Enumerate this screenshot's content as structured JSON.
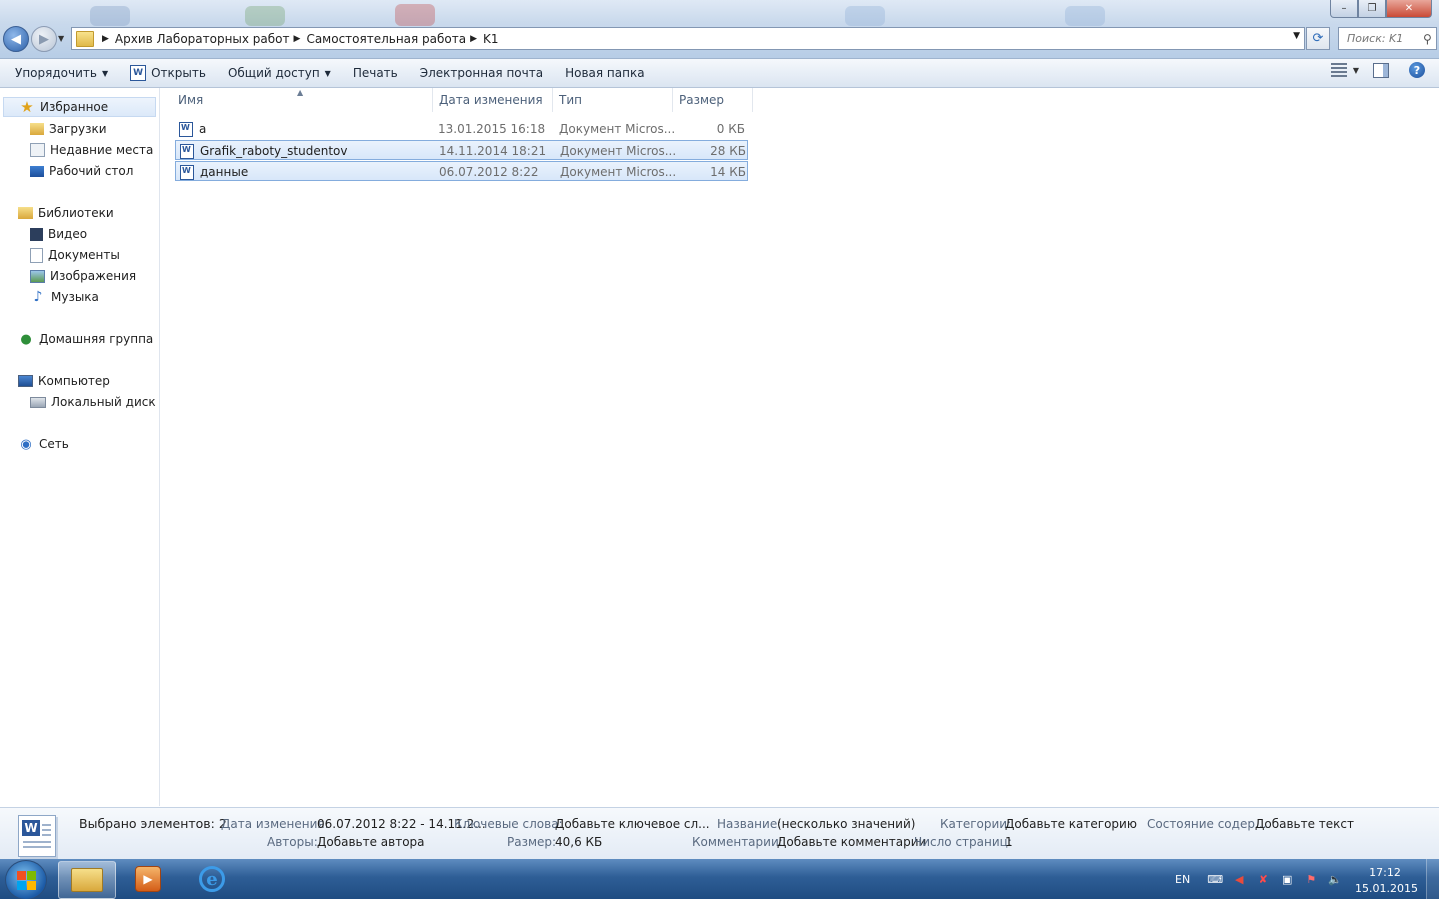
{
  "window": {
    "controls": {
      "minimize": "–",
      "maximize": "❐",
      "close": "✕"
    }
  },
  "address": {
    "breadcrumbs": [
      "Архив Лабораторных работ",
      "Самостоятельная работа",
      "K1"
    ],
    "search_placeholder": "Поиск: K1"
  },
  "toolbar": {
    "organize": "Упорядочить",
    "open": "Открыть",
    "share": "Общий доступ",
    "print": "Печать",
    "email": "Электронная почта",
    "new_folder": "Новая папка"
  },
  "nav": {
    "favorites": "Избранное",
    "downloads": "Загрузки",
    "recent": "Недавние места",
    "desktop": "Рабочий стол",
    "libraries": "Библиотеки",
    "video": "Видео",
    "documents": "Документы",
    "images": "Изображения",
    "music": "Музыка",
    "homegroup": "Домашняя группа",
    "computer": "Компьютер",
    "local_disk": "Локальный диск (С:",
    "network": "Сеть"
  },
  "columns": {
    "name": "Имя",
    "date": "Дата изменения",
    "type": "Тип",
    "size": "Размер"
  },
  "files": [
    {
      "name": "а",
      "date": "13.01.2015 16:18",
      "type": "Документ Micros...",
      "size": "0 КБ",
      "selected": false
    },
    {
      "name": "Grafik_raboty_studentov",
      "date": "14.11.2014 18:21",
      "type": "Документ Micros...",
      "size": "28 КБ",
      "selected": true
    },
    {
      "name": "данные",
      "date": "06.07.2012 8:22",
      "type": "Документ Micros...",
      "size": "14 КБ",
      "selected": true
    }
  ],
  "details": {
    "selected_count": "Выбрано элементов: 2",
    "date_label": "Дата изменения:",
    "date_value": "06.07.2012 8:22 - 14.11.2...",
    "keywords_label": "Ключевые слова:",
    "keywords_value": "Добавьте ключевое сл...",
    "title_label": "Название:",
    "title_value": "(несколько значений)",
    "categories_label": "Категории:",
    "categories_value": "Добавьте категорию",
    "status_label": "Состояние содер...",
    "status_value": "Добавьте текст",
    "authors_label": "Авторы:",
    "authors_value": "Добавьте автора",
    "size_label": "Размер:",
    "size_value": "40,6 КБ",
    "comments_label": "Комментарии:",
    "comments_value": "Добавьте комментарии",
    "pages_label": "Число страниц:",
    "pages_value": "1"
  },
  "taskbar": {
    "lang": "EN",
    "time": "17:12",
    "date": "15.01.2015"
  },
  "colors": {
    "accent": "#2b579a",
    "selection_border": "#84acdd",
    "taskbar": "#2e5e96"
  }
}
